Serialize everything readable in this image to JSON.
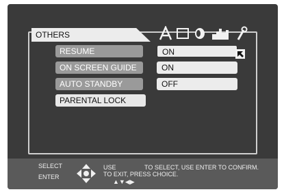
{
  "menu": {
    "title": "OTHERS",
    "tabs": [
      "text-a-icon",
      "monitor-icon",
      "speaker-icon",
      "castle-icon",
      "wrench-icon"
    ]
  },
  "options": [
    {
      "label": "RESUME",
      "value": "ON"
    },
    {
      "label": "ON SCREEN GUIDE",
      "value": "ON"
    },
    {
      "label": "AUTO STANDBY",
      "value": "OFF"
    },
    {
      "label": "PARENTAL LOCK"
    }
  ],
  "footer": {
    "select": "SELECT",
    "enter": "ENTER",
    "use": "USE",
    "exit": "TO EXIT, PRESS CHOICE.",
    "instruction": "TO SELECT,  USE ENTER TO CONFIRM.",
    "arrows": "▲▼◀▶"
  }
}
